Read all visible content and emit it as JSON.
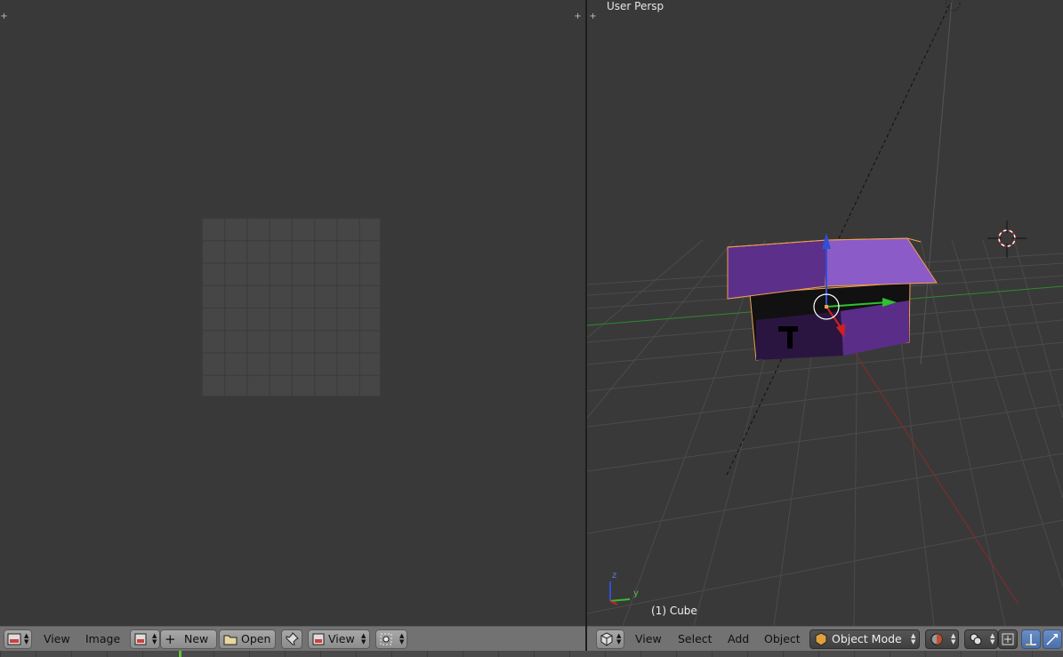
{
  "left_editor": {
    "header": {
      "menu_view": "View",
      "menu_image": "Image",
      "new_button": "New",
      "open_button": "Open",
      "view_select": "View"
    }
  },
  "right_editor": {
    "viewport_label": "User Persp",
    "active_object_label": "(1) Cube",
    "axis_labels": {
      "z": "z",
      "y": "y"
    },
    "header": {
      "menu_view": "View",
      "menu_select": "Select",
      "menu_add": "Add",
      "menu_object": "Object",
      "mode_select": "Object Mode"
    }
  },
  "colors": {
    "background": "#393939",
    "header": "#727272",
    "selection_outline": "#f0a050",
    "object_purple": "#7a4aa8",
    "x_axis": "#c03030",
    "y_axis": "#50b040",
    "z_axis": "#3050d0"
  }
}
